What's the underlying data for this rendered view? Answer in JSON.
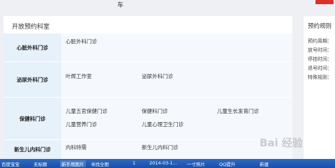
{
  "top_stub": "车",
  "main": {
    "title": "开放预约科室",
    "departments": [
      {
        "name": "心脏外科门诊",
        "clinics": [
          "心脏外科门诊"
        ]
      },
      {
        "name": "泌尿外科门诊",
        "clinics": [
          "叶辉工作室",
          "泌尿外科门诊"
        ]
      },
      {
        "name": "保健科门诊",
        "clinics": [
          "儿童五官保健门诊",
          "保健科门诊",
          "儿童生长发育门诊",
          "儿童营养门诊",
          "儿童心理卫生门诊"
        ]
      },
      {
        "name": "新生儿内科门诊",
        "clinics": [
          "内科特需",
          "新生儿内科门诊"
        ]
      }
    ]
  },
  "side": {
    "title": "预约规则",
    "rules": [
      "预约周期：",
      "放号时间：",
      "停挂时间：",
      "退号时间：",
      "特殊规则："
    ]
  },
  "taskbar": {
    "items": [
      "百度宝宝",
      "无标题",
      "新手用图片",
      "寻找全图",
      "1",
      "2014-03-1...",
      "一寸照片",
      "QQ提升",
      "新建"
    ]
  },
  "watermark": "Bai 经验"
}
